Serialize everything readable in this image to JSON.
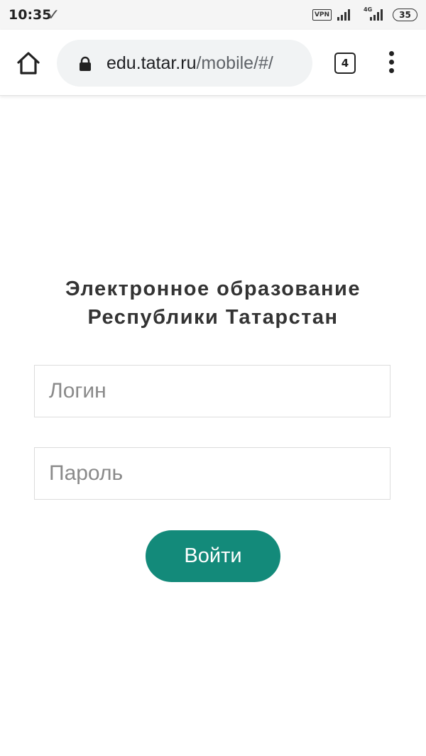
{
  "status_bar": {
    "time": "10:35",
    "check_glyph": "✓",
    "vpn_label": "VPN",
    "network_type": "4G",
    "battery_level": "35"
  },
  "browser": {
    "url_domain": "edu.tatar.ru",
    "url_path": "/mobile/#/",
    "tab_count": "4",
    "icons": [
      "home-icon",
      "lock-icon",
      "tabs-icon",
      "more-vert-icon"
    ]
  },
  "login_form": {
    "title_line1": "Электронное образование",
    "title_line2": "Республики Татарстан",
    "login_placeholder": "Логин",
    "password_placeholder": "Пароль",
    "submit_label": "Войти"
  },
  "colors": {
    "accent": "#138a7a",
    "url_bar_bg": "#f1f3f4",
    "title_text": "#333333"
  }
}
